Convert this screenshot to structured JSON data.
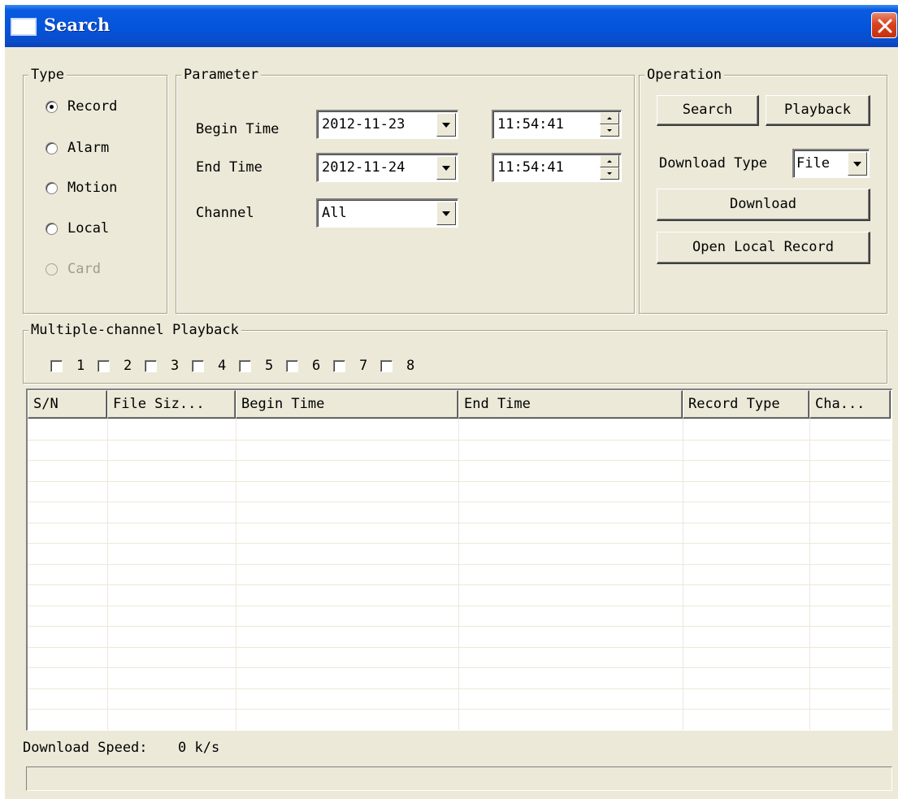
{
  "window": {
    "title": "Search"
  },
  "type_group": {
    "legend": "Type",
    "options": [
      {
        "label": "Record",
        "checked": true,
        "enabled": true
      },
      {
        "label": "Alarm",
        "checked": false,
        "enabled": true
      },
      {
        "label": "Motion",
        "checked": false,
        "enabled": true
      },
      {
        "label": "Local",
        "checked": false,
        "enabled": true
      },
      {
        "label": "Card",
        "checked": false,
        "enabled": false
      }
    ]
  },
  "parameter_group": {
    "legend": "Parameter",
    "begin_time_label": "Begin Time",
    "begin_date": "2012-11-23",
    "begin_clock": "11:54:41",
    "end_time_label": "End Time",
    "end_date": "2012-11-24",
    "end_clock": "11:54:41",
    "channel_label": "Channel",
    "channel_value": "All"
  },
  "operation_group": {
    "legend": "Operation",
    "search_label": "Search",
    "playback_label": "Playback",
    "download_type_label": "Download Type",
    "download_type_value": "File",
    "download_label": "Download",
    "open_local_label": "Open Local Record"
  },
  "multi_playback": {
    "legend": "Multiple-channel Playback",
    "channels": [
      "1",
      "2",
      "3",
      "4",
      "5",
      "6",
      "7",
      "8"
    ]
  },
  "table": {
    "columns": [
      "S/N",
      "File Siz...",
      "Begin Time",
      "End Time",
      "Record Type",
      "Cha..."
    ],
    "rows": []
  },
  "status": {
    "download_speed_label": "Download Speed:",
    "download_speed_value": "0 k/s",
    "progress": 0
  },
  "colors": {
    "title_bar": "#0454dc",
    "dialog_bg": "#ece9d8",
    "close_button": "#d8431f"
  }
}
